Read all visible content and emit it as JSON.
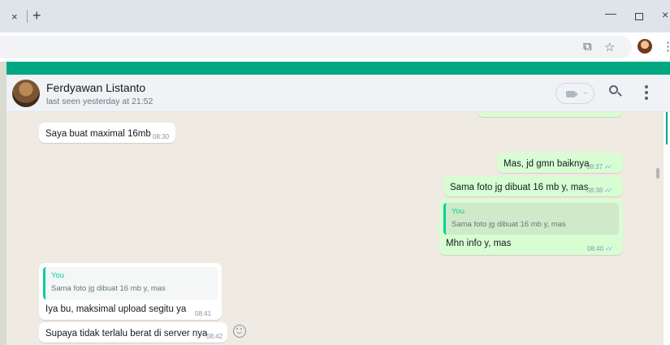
{
  "browser": {
    "tab_close": "×",
    "new_tab": "+",
    "minimize": "—",
    "close": "×",
    "kebab": "⋮"
  },
  "colors": {
    "accent": "#00a884",
    "outgoing_bubble": "#d9fdd3",
    "incoming_bubble": "#ffffff",
    "chat_bg": "#efeae2",
    "read_ticks": "#53bdeb"
  },
  "header": {
    "contact_name": "Ferdyawan Listanto",
    "last_seen": "last seen yesterday at 21:52",
    "video_caret": "⌄"
  },
  "messages": [
    {
      "direction": "in",
      "text": "Saya buat maximal 16mb",
      "time": "08:30"
    },
    {
      "direction": "out",
      "text": "Mas, jd gmn baiknya",
      "time": "08:37",
      "ticks": "✓✓"
    },
    {
      "direction": "out",
      "text": "Sama foto jg dibuat 16 mb y, mas",
      "time": "08:38",
      "ticks": "✓✓"
    },
    {
      "direction": "out",
      "quote_author": "You",
      "quote_text": "Sama foto jg dibuat 16 mb y, mas",
      "text": "Mhn info y, mas",
      "time": "08:40",
      "ticks": "✓✓"
    },
    {
      "direction": "in",
      "quote_author": "You",
      "quote_text": "Sama foto jg dibuat 16 mb y, mas",
      "text": "Iya bu, maksimal upload segitu ya",
      "time": "08:41"
    },
    {
      "direction": "in",
      "text": "Supaya tidak terlalu berat di server nya",
      "time": "08:42"
    }
  ]
}
